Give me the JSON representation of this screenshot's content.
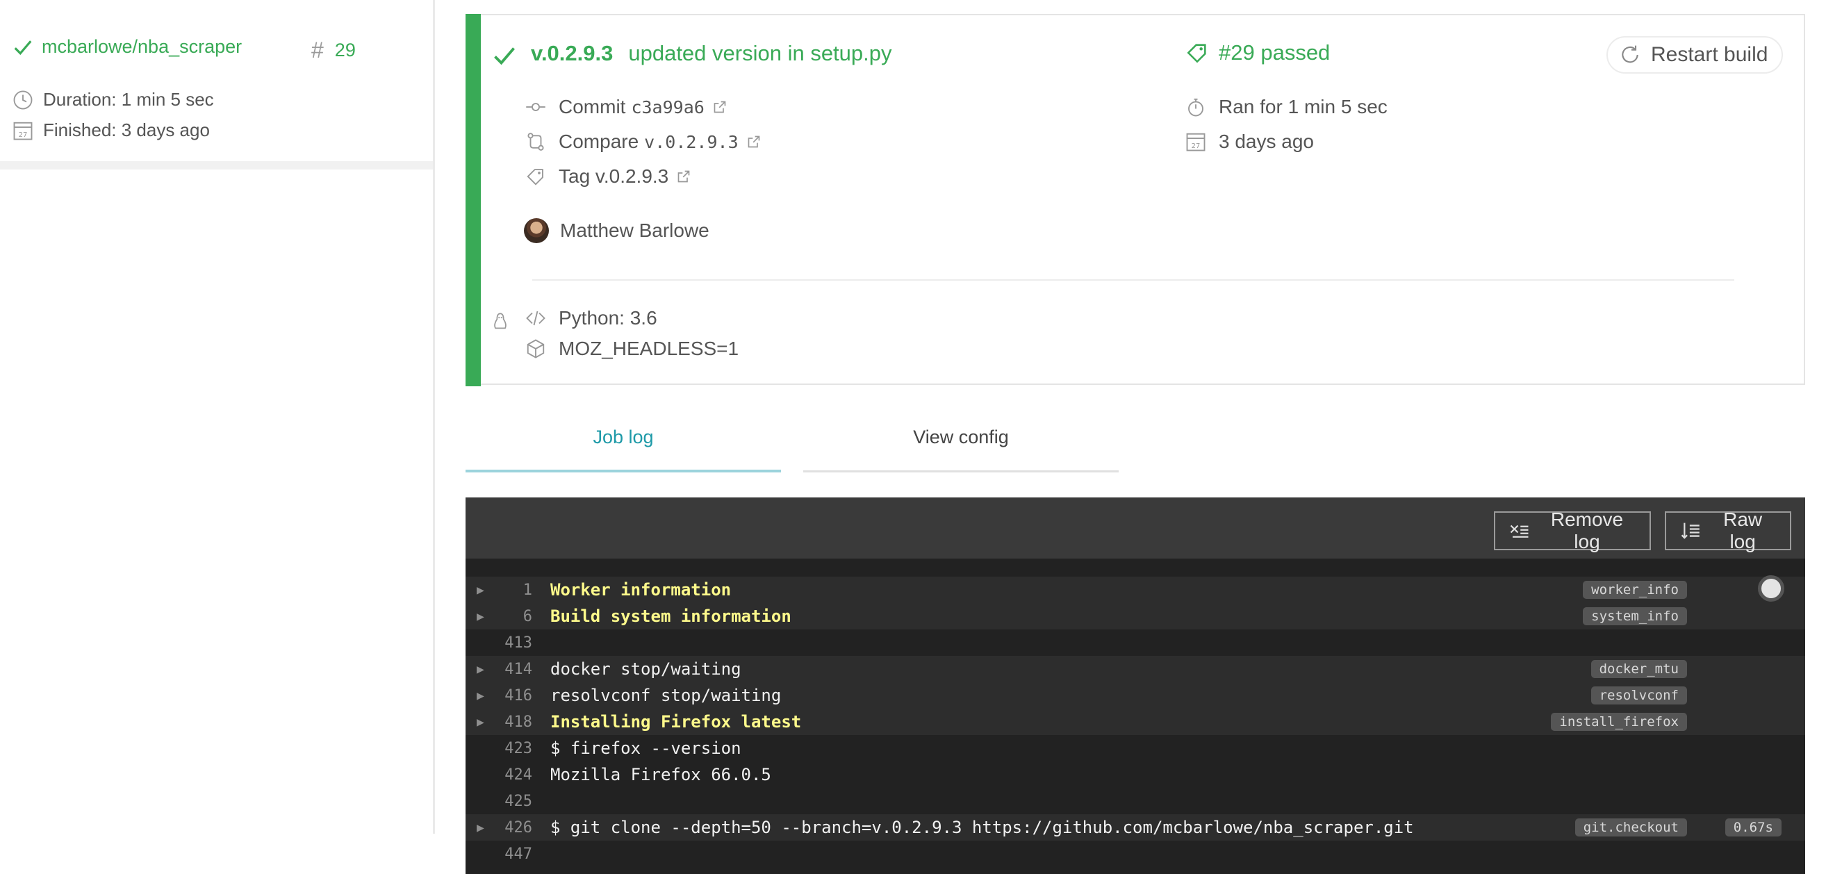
{
  "sidebar": {
    "repo_name": "mcbarlowe/nba_scraper",
    "build_hash_symbol": "#",
    "build_number": "29",
    "duration": "Duration: 1 min 5 sec",
    "finished": "Finished: 3 days ago"
  },
  "build": {
    "version": "v.0.2.9.3",
    "message": "updated version in setup.py",
    "status": "#29 passed",
    "commit_label": "Commit",
    "commit_sha": "c3a99a6",
    "compare_label": "Compare",
    "compare_ref": "v.0.2.9.3",
    "tag": "Tag v.0.2.9.3",
    "author": "Matthew Barlowe",
    "ran_for": "Ran for 1 min 5 sec",
    "finished_ago": "3 days ago",
    "language": "Python: 3.6",
    "env": "MOZ_HEADLESS=1",
    "restart_label": "Restart build",
    "status_color": "#39aa56"
  },
  "tabs": {
    "job_log": "Job log",
    "view_config": "View config"
  },
  "log": {
    "remove_label": "Remove log",
    "raw_label": "Raw log",
    "lines": [
      {
        "num": "1",
        "text": "Worker information",
        "highlight": true,
        "fold": true,
        "label": "worker_info",
        "duration": ""
      },
      {
        "num": "6",
        "text": "Build system information",
        "highlight": true,
        "fold": true,
        "label": "system_info",
        "duration": ""
      },
      {
        "num": "413",
        "text": "",
        "highlight": false,
        "fold": false,
        "label": "",
        "duration": ""
      },
      {
        "num": "414",
        "text": "docker stop/waiting",
        "highlight": false,
        "fold": true,
        "label": "docker_mtu",
        "duration": ""
      },
      {
        "num": "416",
        "text": "resolvconf stop/waiting",
        "highlight": false,
        "fold": true,
        "label": "resolvconf",
        "duration": ""
      },
      {
        "num": "418",
        "text": "Installing Firefox latest",
        "highlight": true,
        "fold": true,
        "label": "install_firefox",
        "duration": ""
      },
      {
        "num": "423",
        "text": "$ firefox --version",
        "highlight": false,
        "fold": false,
        "label": "",
        "duration": ""
      },
      {
        "num": "424",
        "text": "Mozilla Firefox 66.0.5",
        "highlight": false,
        "fold": false,
        "label": "",
        "duration": ""
      },
      {
        "num": "425",
        "text": "",
        "highlight": false,
        "fold": false,
        "label": "",
        "duration": ""
      },
      {
        "num": "426",
        "text": "$ git clone --depth=50 --branch=v.0.2.9.3 https://github.com/mcbarlowe/nba_scraper.git",
        "highlight": false,
        "fold": true,
        "label": "git.checkout",
        "duration": "0.67s"
      },
      {
        "num": "447",
        "text": "",
        "highlight": false,
        "fold": false,
        "label": "",
        "duration": ""
      }
    ]
  }
}
